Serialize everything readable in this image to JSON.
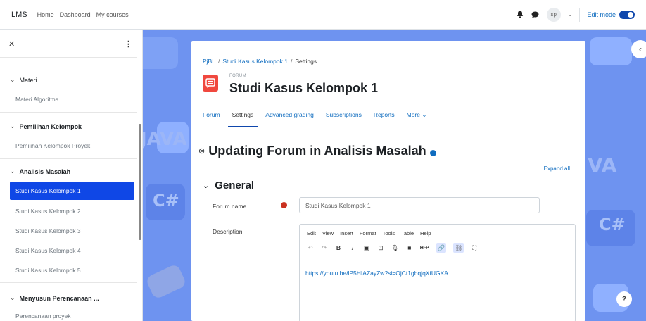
{
  "navbar": {
    "brand": "LMS",
    "links": [
      "Home",
      "Dashboard",
      "My courses"
    ],
    "user_initials": "sp",
    "edit_mode_label": "Edit mode",
    "edit_mode_on": true
  },
  "drawer": {
    "sections": [
      {
        "title": "Materi",
        "bold": false,
        "items": [
          "Materi Algoritma"
        ]
      },
      {
        "title": "Pemilihan Kelompok",
        "bold": true,
        "items": [
          "Pemilihan Kelompok Proyek"
        ]
      },
      {
        "title": "Analisis Masalah",
        "bold": true,
        "items": [
          "Studi Kasus Kelompok 1",
          "Studi Kasus Kelompok 2",
          "Studi Kasus Kelompok 3",
          "Studi Kasus Kelompok 4",
          "Studi Kasus Kelompok 5"
        ]
      },
      {
        "title": "Menyusun Perencanaan ...",
        "bold": true,
        "items": [
          "Perencanaan proyek"
        ]
      }
    ],
    "active_item": "Studi Kasus Kelompok 1"
  },
  "breadcrumb": {
    "course": "PjBL",
    "activity": "Studi Kasus Kelompok 1",
    "current": "Settings"
  },
  "activity": {
    "kicker": "FORUM",
    "title": "Studi Kasus Kelompok 1"
  },
  "tabs": [
    "Forum",
    "Settings",
    "Advanced grading",
    "Subscriptions",
    "Reports",
    "More"
  ],
  "active_tab": "Settings",
  "page": {
    "heading": "Updating Forum in Analisis Masalah",
    "expand_all": "Expand all",
    "section_general": "General"
  },
  "form": {
    "forum_name_label": "Forum name",
    "forum_name_value": "Studi Kasus Kelompok 1",
    "description_label": "Description",
    "editor_menus": [
      "Edit",
      "View",
      "Insert",
      "Format",
      "Tools",
      "Table",
      "Help"
    ],
    "editor_content": "https://youtu.be/lP5HIAZayZw?si=OjCt1gbqjqXfUGKA"
  },
  "colors": {
    "accent": "#0f47e6",
    "link": "#0f6cbf",
    "background": "#6e93f0",
    "forum_icon": "#f0483e"
  }
}
